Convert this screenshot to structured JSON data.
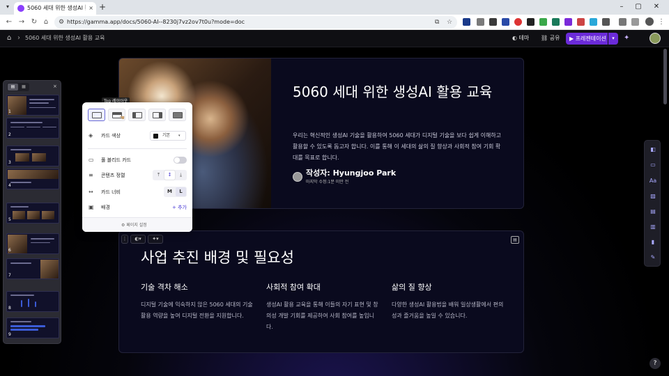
{
  "browser": {
    "tab_title": "5060 세대 위한 생성AI 활용 교",
    "tab_close": "×",
    "new_tab": "+",
    "url": "https://gamma.app/docs/5060-AI--8230j7vz2ov7t0u?mode=doc",
    "window_minimize": "–",
    "window_maximize": "▢",
    "window_close": "✕"
  },
  "header": {
    "breadcrumb": "5060 세대 위한 생성AI 활용 교육",
    "theme_label": "테마",
    "share_label": "공유",
    "present_label": "▶ 프레젠테이션"
  },
  "slides_panel": {
    "close": "×",
    "thumbnails": [
      "1",
      "2",
      "3",
      "4",
      "5",
      "6",
      "7",
      "8",
      "9"
    ]
  },
  "card_layout_popup": {
    "tooltip": "Top 레이아웃",
    "card_color_label": "카드 색상",
    "card_color_value": "기본",
    "full_bleed_label": "풀 블리드 카드",
    "content_align_label": "콘텐츠 정렬",
    "card_width_label": "카드 너비",
    "width_m": "M",
    "width_l": "L",
    "background_label": "배경",
    "background_add": "+ 추가",
    "page_settings": "페이지 설정"
  },
  "card1": {
    "title": "5060 세대 위한 생성AI 활용 교육",
    "body": "우리는 혁신적인 생성AI 기술을 활용하여 5060 세대가 디지털 기술을 보다 쉽게 이해하고 활용할 수 있도록 돕고자 합니다. 이를 통해 이 세대의 삶의 질 향상과 사회적 참여 기회 확대를 목표로 합니다.",
    "author": "작성자: Hyungjoo Park",
    "last_edited": "마지막 수정:1분 미만 전"
  },
  "card2": {
    "title": "사업 추진 배경 및 필요성",
    "columns": [
      {
        "heading": "기술 격차 해소",
        "body": "디지털 기술에 익숙하지 않은 5060 세대의 기술 활용 역량을 높여 디지털 전환을 지원합니다."
      },
      {
        "heading": "사회적 참여 확대",
        "body": "생성AI 활용 교육을 통해 이들의 자기 표현 및 창의성 개발 기회를 제공하여 사회 참여를 높입니다."
      },
      {
        "heading": "삶의 질 향상",
        "body": "다양한 생성AI 활용법을 배워 일상생활에서 편의성과 즐거움을 높일 수 있습니다."
      }
    ]
  },
  "help": "?"
}
